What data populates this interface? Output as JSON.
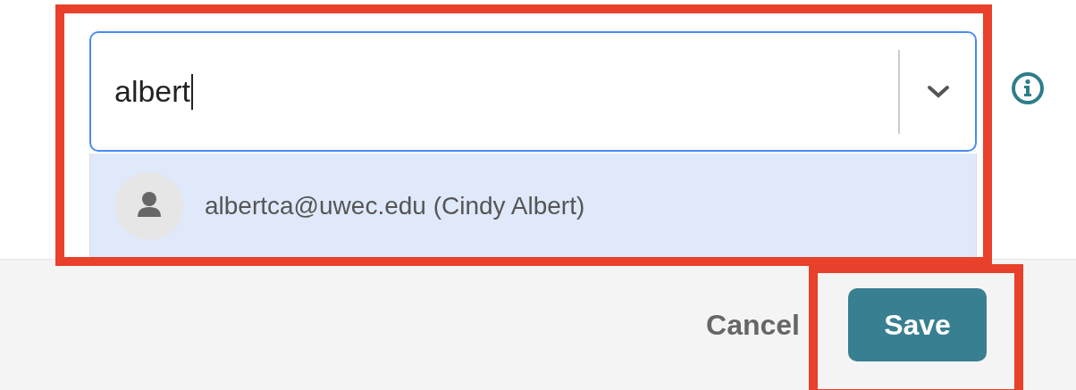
{
  "search": {
    "value": "albert",
    "focused": true
  },
  "options": [
    {
      "label": "albertca@uwec.edu (Cindy Albert)",
      "selected": true
    }
  ],
  "buttons": [
    {
      "label": "Cancel",
      "kind": "text"
    },
    {
      "label": "Save",
      "kind": "primary"
    }
  ]
}
